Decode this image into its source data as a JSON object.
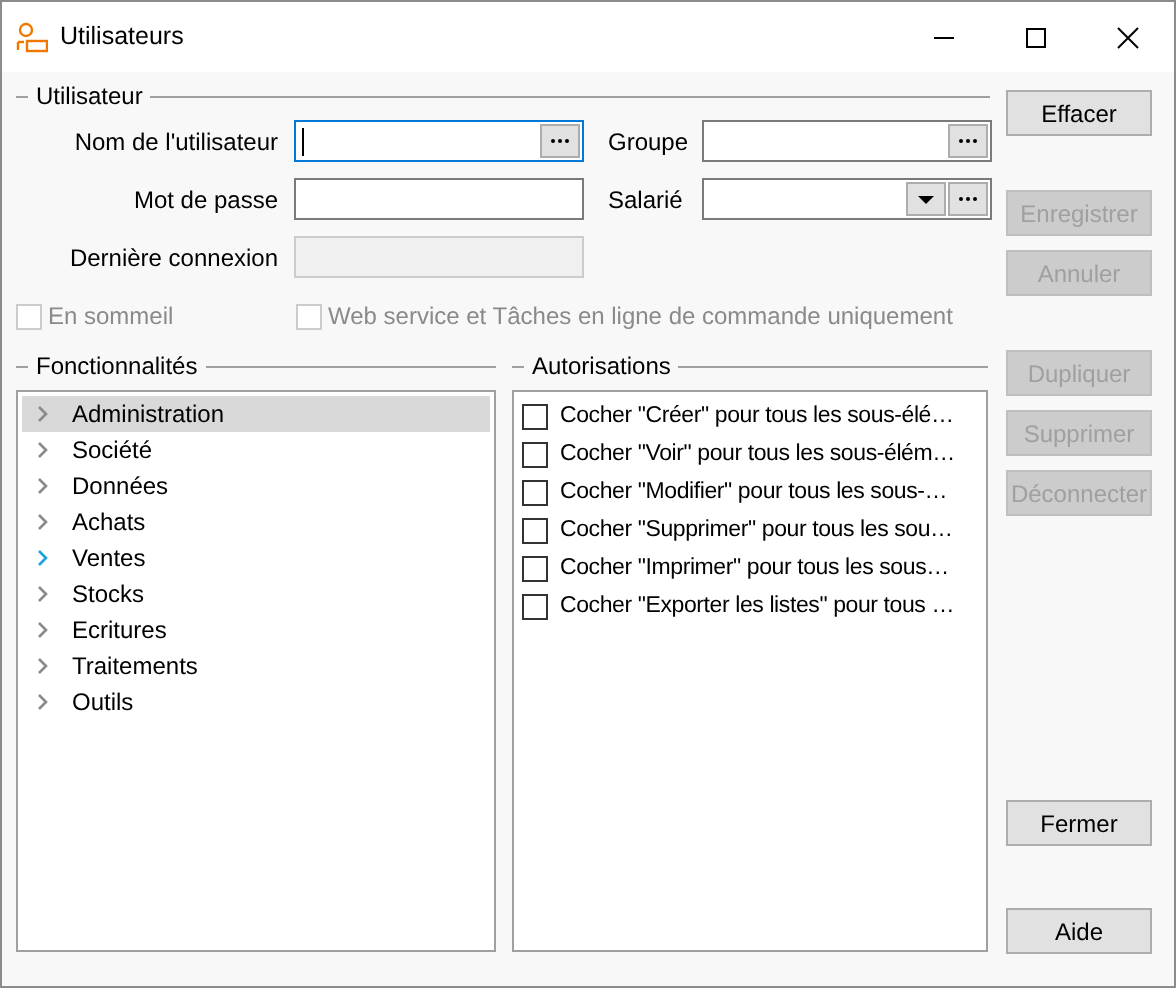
{
  "window": {
    "title": "Utilisateurs",
    "controls": [
      {
        "kind": "minimize"
      },
      {
        "kind": "maximize"
      },
      {
        "kind": "close"
      }
    ]
  },
  "user_group": {
    "title": "Utilisateur",
    "fields": [
      {
        "label": "Nom de l'utilisateur",
        "kind": "lookup",
        "focused": true,
        "disabled": false
      },
      {
        "label": "Mot de passe",
        "kind": "text",
        "focused": false,
        "disabled": false
      },
      {
        "label": "Dernière connexion",
        "kind": "text",
        "focused": false,
        "disabled": true
      }
    ],
    "side_fields": [
      {
        "label": "Groupe",
        "kind": "lookup",
        "focused": false,
        "disabled": false
      },
      {
        "label": "Salarié",
        "kind": "combo-lookup",
        "focused": false,
        "disabled": false
      }
    ],
    "checkboxes": [
      {
        "label": "En sommeil",
        "checked": false,
        "disabled": true
      },
      {
        "label": "Web service et Tâches en ligne de commande uniquement",
        "checked": false,
        "disabled": true
      }
    ]
  },
  "features": {
    "title": "Fonctionnalités",
    "items": [
      {
        "label": "Administration",
        "selected": true,
        "expanded": false,
        "hovered": false
      },
      {
        "label": "Société",
        "selected": false,
        "expanded": false,
        "hovered": false
      },
      {
        "label": "Données",
        "selected": false,
        "expanded": false,
        "hovered": false
      },
      {
        "label": "Achats",
        "selected": false,
        "expanded": false,
        "hovered": false
      },
      {
        "label": "Ventes",
        "selected": false,
        "expanded": false,
        "hovered": true
      },
      {
        "label": "Stocks",
        "selected": false,
        "expanded": false,
        "hovered": false
      },
      {
        "label": "Ecritures",
        "selected": false,
        "expanded": false,
        "hovered": false
      },
      {
        "label": "Traitements",
        "selected": false,
        "expanded": false,
        "hovered": false
      },
      {
        "label": "Outils",
        "selected": false,
        "expanded": false,
        "hovered": false
      }
    ]
  },
  "permissions": {
    "title": "Autorisations",
    "items": [
      {
        "label": "Cocher \"Créer\" pour tous les sous-élé…",
        "checked": false
      },
      {
        "label": "Cocher \"Voir\" pour tous les sous-élém…",
        "checked": false
      },
      {
        "label": "Cocher \"Modifier\" pour tous les sous-…",
        "checked": false
      },
      {
        "label": "Cocher \"Supprimer\" pour tous les sou…",
        "checked": false
      },
      {
        "label": "Cocher \"Imprimer\" pour tous les sous…",
        "checked": false
      },
      {
        "label": "Cocher \"Exporter les listes\" pour tous …",
        "checked": false
      }
    ]
  },
  "button_groups": [
    [
      {
        "label": "Effacer",
        "disabled": false
      }
    ],
    [
      {
        "label": "Enregistrer",
        "disabled": true
      },
      {
        "label": "Annuler",
        "disabled": true
      }
    ],
    [
      {
        "label": "Dupliquer",
        "disabled": true
      },
      {
        "label": "Supprimer",
        "disabled": true
      },
      {
        "label": "Déconnecter",
        "disabled": true
      }
    ],
    [
      {
        "label": "Fermer",
        "disabled": false
      }
    ],
    [
      {
        "label": "Aide",
        "disabled": false
      }
    ]
  ]
}
